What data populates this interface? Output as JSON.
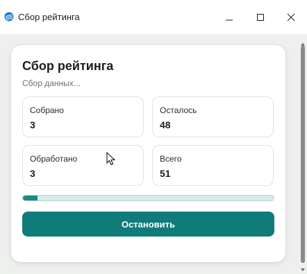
{
  "window": {
    "title": "Сбор рейтинга",
    "accent_color": "#2f7fd3"
  },
  "card": {
    "title": "Сбор рейтинга",
    "status": "Сбор данных..."
  },
  "stats": {
    "collected": {
      "label": "Собрано",
      "value": "3"
    },
    "remaining": {
      "label": "Осталось",
      "value": "48"
    },
    "processed": {
      "label": "Обработано",
      "value": "3"
    },
    "total": {
      "label": "Всего",
      "value": "51"
    }
  },
  "progress": {
    "fraction": 0.0588,
    "color": "#1d8a84"
  },
  "actions": {
    "stop_label": "Остановить",
    "stop_color": "#107c79"
  }
}
